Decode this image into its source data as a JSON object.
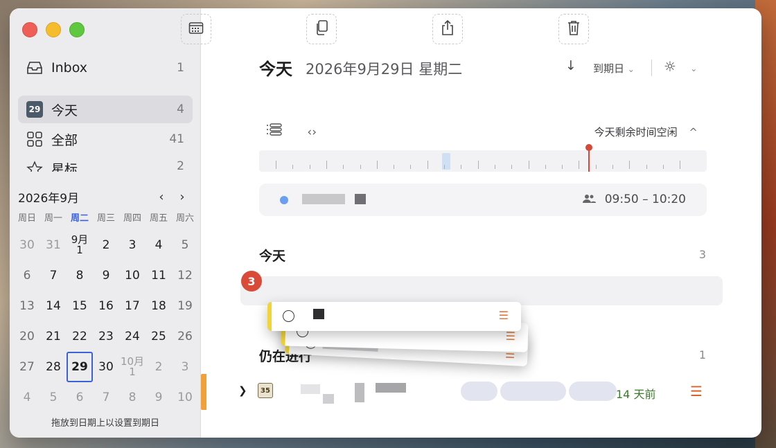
{
  "colors": {
    "accent": "#3a62d6",
    "now_marker": "#d34a3a",
    "task_flag": "#f0d43a",
    "menu_orange": "#e07a3a",
    "ago_green": "#3b7a2a"
  },
  "sidebar": {
    "items": [
      {
        "label": "Inbox",
        "count": "1",
        "icon": "inbox-icon"
      },
      {
        "label": "今天",
        "count": "4",
        "icon": "calendar-day-icon",
        "badge": "29"
      },
      {
        "label": "全部",
        "count": "41",
        "icon": "grid-icon"
      },
      {
        "label": "星标",
        "count": "2",
        "icon": "star-icon"
      }
    ]
  },
  "calendar": {
    "title": "2026年9月",
    "prev": "‹",
    "next": "›",
    "weekdays": [
      "周日",
      "周一",
      "周二",
      "周三",
      "周四",
      "周五",
      "周六"
    ],
    "weeks": [
      [
        "30",
        "31",
        "9月\n1",
        "2",
        "3",
        "4",
        "5"
      ],
      [
        "6",
        "7",
        "8",
        "9",
        "10",
        "11",
        "12"
      ],
      [
        "13",
        "14",
        "15",
        "16",
        "17",
        "18",
        "19"
      ],
      [
        "20",
        "21",
        "22",
        "23",
        "24",
        "25",
        "26"
      ],
      [
        "27",
        "28",
        "29",
        "30",
        "10月\n1",
        "2",
        "3"
      ],
      [
        "4",
        "5",
        "6",
        "7",
        "8",
        "9",
        "10"
      ]
    ]
  },
  "drop_hint": "拖放到日期上以设置到期日",
  "toolbar": {
    "icons": [
      "calendar-grid-icon",
      "duplicate-icon",
      "share-icon",
      "trash-icon"
    ]
  },
  "header": {
    "title": "今天",
    "date": "2026年9月29日 星期二",
    "sort_label": "到期日",
    "chevron": "⌄"
  },
  "timeline": {
    "free_time_label": "今天剩余时间空闲",
    "free_time_chevron": "^"
  },
  "event": {
    "time": "09:50 – 10:20"
  },
  "today_section": {
    "title": "今天",
    "count": "3"
  },
  "drag": {
    "badge": "3"
  },
  "stale_section": {
    "title": "仍在进行",
    "count": "1"
  },
  "task": {
    "cal_number": "35",
    "ago": "14 天前"
  }
}
